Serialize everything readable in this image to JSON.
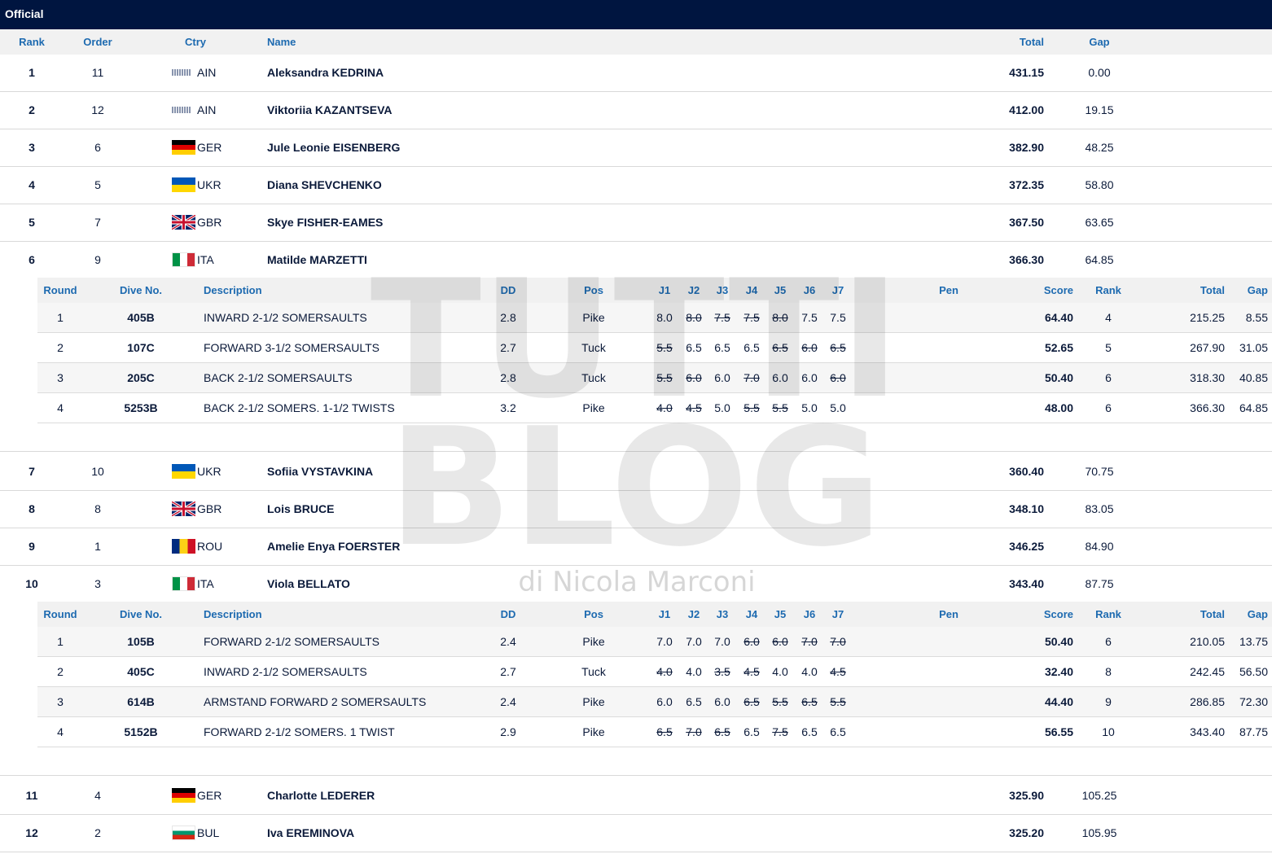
{
  "status_bar": {
    "label": "Official"
  },
  "columns": {
    "rank": "Rank",
    "order": "Order",
    "ctry": "Ctry",
    "name": "Name",
    "total": "Total",
    "gap": "Gap"
  },
  "detail_columns": {
    "round": "Round",
    "dive": "Dive No.",
    "desc": "Description",
    "dd": "DD",
    "pos": "Pos",
    "j1": "J1",
    "j2": "J2",
    "j3": "J3",
    "j4": "J4",
    "j5": "J5",
    "j6": "J6",
    "j7": "J7",
    "pen": "Pen",
    "score": "Score",
    "rank": "Rank",
    "total": "Total",
    "gap": "Gap"
  },
  "athletes": [
    {
      "rank": "1",
      "order": "11",
      "ctry": "AIN",
      "flag": "ain",
      "name": "Aleksandra KEDRINA",
      "total": "431.15",
      "gap": "0.00"
    },
    {
      "rank": "2",
      "order": "12",
      "ctry": "AIN",
      "flag": "ain",
      "name": "Viktoriia KAZANTSEVA",
      "total": "412.00",
      "gap": "19.15"
    },
    {
      "rank": "3",
      "order": "6",
      "ctry": "GER",
      "flag": "ger",
      "name": "Jule Leonie EISENBERG",
      "total": "382.90",
      "gap": "48.25"
    },
    {
      "rank": "4",
      "order": "5",
      "ctry": "UKR",
      "flag": "ukr",
      "name": "Diana SHEVCHENKO",
      "total": "372.35",
      "gap": "58.80"
    },
    {
      "rank": "5",
      "order": "7",
      "ctry": "GBR",
      "flag": "gbr",
      "name": "Skye FISHER-EAMES",
      "total": "367.50",
      "gap": "63.65"
    },
    {
      "rank": "6",
      "order": "9",
      "ctry": "ITA",
      "flag": "ita",
      "name": "Matilde MARZETTI",
      "total": "366.30",
      "gap": "64.85",
      "dives": [
        {
          "round": "1",
          "dive": "405B",
          "desc": "INWARD 2-1/2 SOMERSAULTS",
          "dd": "2.8",
          "pos": "Pike",
          "judges": [
            "8.0",
            "8.0",
            "7.5",
            "7.5",
            "8.0",
            "7.5",
            "7.5"
          ],
          "struck": [
            false,
            true,
            true,
            true,
            true,
            false,
            false
          ],
          "pen": "",
          "score": "64.40",
          "rank": "4",
          "total": "215.25",
          "gap": "8.55"
        },
        {
          "round": "2",
          "dive": "107C",
          "desc": "FORWARD 3-1/2 SOMERSAULTS",
          "dd": "2.7",
          "pos": "Tuck",
          "judges": [
            "5.5",
            "6.5",
            "6.5",
            "6.5",
            "6.5",
            "6.0",
            "6.5"
          ],
          "struck": [
            true,
            false,
            false,
            false,
            true,
            true,
            true
          ],
          "pen": "",
          "score": "52.65",
          "rank": "5",
          "total": "267.90",
          "gap": "31.05"
        },
        {
          "round": "3",
          "dive": "205C",
          "desc": "BACK 2-1/2 SOMERSAULTS",
          "dd": "2.8",
          "pos": "Tuck",
          "judges": [
            "5.5",
            "6.0",
            "6.0",
            "7.0",
            "6.0",
            "6.0",
            "6.0"
          ],
          "struck": [
            true,
            true,
            false,
            true,
            false,
            false,
            true
          ],
          "pen": "",
          "score": "50.40",
          "rank": "6",
          "total": "318.30",
          "gap": "40.85"
        },
        {
          "round": "4",
          "dive": "5253B",
          "desc": "BACK 2-1/2 SOMERS. 1-1/2 TWISTS",
          "dd": "3.2",
          "pos": "Pike",
          "judges": [
            "4.0",
            "4.5",
            "5.0",
            "5.5",
            "5.5",
            "5.0",
            "5.0"
          ],
          "struck": [
            true,
            true,
            false,
            true,
            true,
            false,
            false
          ],
          "pen": "",
          "score": "48.00",
          "rank": "6",
          "total": "366.30",
          "gap": "64.85"
        }
      ]
    },
    {
      "rank": "7",
      "order": "10",
      "ctry": "UKR",
      "flag": "ukr",
      "name": "Sofiia VYSTAVKINA",
      "total": "360.40",
      "gap": "70.75"
    },
    {
      "rank": "8",
      "order": "8",
      "ctry": "GBR",
      "flag": "gbr",
      "name": "Lois BRUCE",
      "total": "348.10",
      "gap": "83.05"
    },
    {
      "rank": "9",
      "order": "1",
      "ctry": "ROU",
      "flag": "rou",
      "name": "Amelie Enya FOERSTER",
      "total": "346.25",
      "gap": "84.90"
    },
    {
      "rank": "10",
      "order": "3",
      "ctry": "ITA",
      "flag": "ita",
      "name": "Viola BELLATO",
      "total": "343.40",
      "gap": "87.75",
      "dives": [
        {
          "round": "1",
          "dive": "105B",
          "desc": "FORWARD 2-1/2 SOMERSAULTS",
          "dd": "2.4",
          "pos": "Pike",
          "judges": [
            "7.0",
            "7.0",
            "7.0",
            "6.0",
            "6.0",
            "7.0",
            "7.0"
          ],
          "struck": [
            false,
            false,
            false,
            true,
            true,
            true,
            true
          ],
          "pen": "",
          "score": "50.40",
          "rank": "6",
          "total": "210.05",
          "gap": "13.75"
        },
        {
          "round": "2",
          "dive": "405C",
          "desc": "INWARD 2-1/2 SOMERSAULTS",
          "dd": "2.7",
          "pos": "Tuck",
          "judges": [
            "4.0",
            "4.0",
            "3.5",
            "4.5",
            "4.0",
            "4.0",
            "4.5"
          ],
          "struck": [
            true,
            false,
            true,
            true,
            false,
            false,
            true
          ],
          "pen": "",
          "score": "32.40",
          "rank": "8",
          "total": "242.45",
          "gap": "56.50"
        },
        {
          "round": "3",
          "dive": "614B",
          "desc": "ARMSTAND FORWARD 2 SOMERSAULTS",
          "dd": "2.4",
          "pos": "Pike",
          "judges": [
            "6.0",
            "6.5",
            "6.0",
            "6.5",
            "5.5",
            "6.5",
            "5.5"
          ],
          "struck": [
            false,
            false,
            false,
            true,
            true,
            true,
            true
          ],
          "pen": "",
          "score": "44.40",
          "rank": "9",
          "total": "286.85",
          "gap": "72.30"
        },
        {
          "round": "4",
          "dive": "5152B",
          "desc": "FORWARD 2-1/2 SOMERS. 1 TWIST",
          "dd": "2.9",
          "pos": "Pike",
          "judges": [
            "6.5",
            "7.0",
            "6.5",
            "6.5",
            "7.5",
            "6.5",
            "6.5"
          ],
          "struck": [
            true,
            true,
            true,
            false,
            true,
            false,
            false
          ],
          "pen": "",
          "score": "56.55",
          "rank": "10",
          "total": "343.40",
          "gap": "87.75"
        }
      ]
    },
    {
      "rank": "11",
      "order": "4",
      "ctry": "GER",
      "flag": "ger",
      "name": "Charlotte LEDERER",
      "total": "325.90",
      "gap": "105.25"
    },
    {
      "rank": "12",
      "order": "2",
      "ctry": "BUL",
      "flag": "bul",
      "name": "Iva EREMINOVA",
      "total": "325.20",
      "gap": "105.95"
    }
  ],
  "watermark": {
    "line1": "TUTTI",
    "line2": "BLOG",
    "line3": "di Nicola Marconi"
  }
}
